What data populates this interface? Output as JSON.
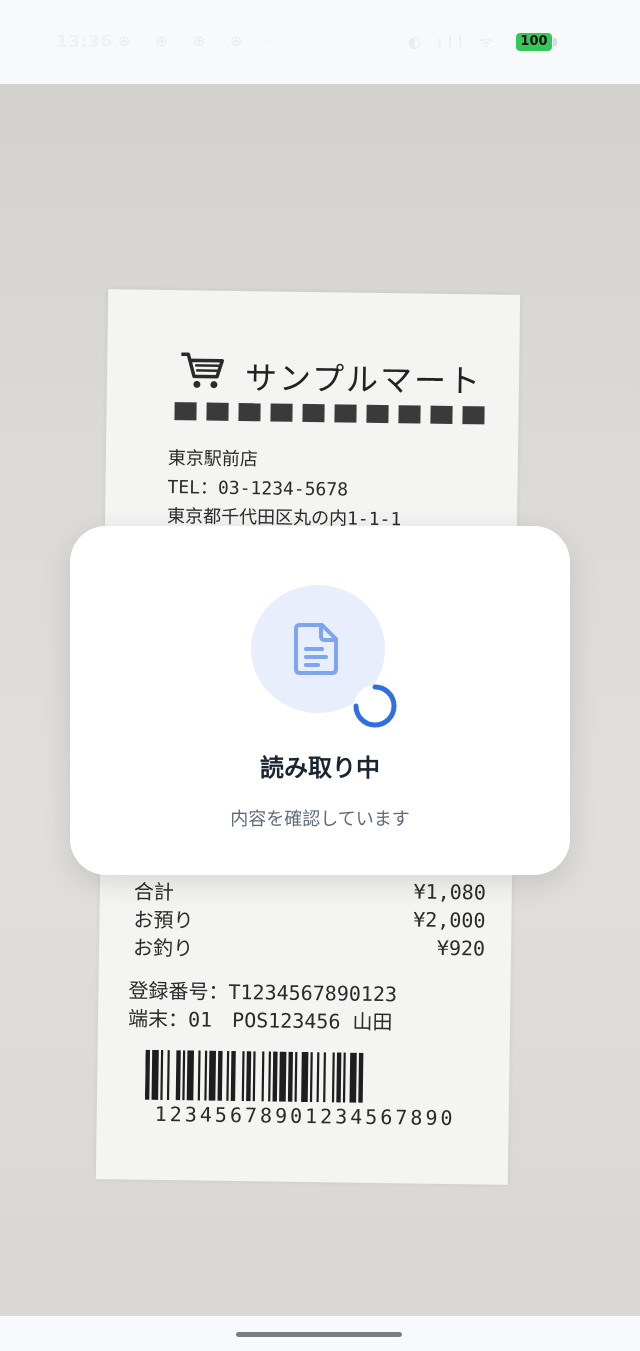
{
  "status_bar": {
    "time": "13:36",
    "left_icons": "⊕ ⊕ ⊕ ⊕ ·",
    "right_icons": "◐ ıll ᯤ",
    "battery": "100"
  },
  "receipt": {
    "store_name": "サンプルマート",
    "branch": "東京駅前店",
    "tel": "TEL：03-1234-5678",
    "address": "東京都千代田区丸の内1-1-1",
    "total_label": "合計",
    "total_value": "¥1,080",
    "paid_label": "お預り",
    "paid_value": "¥2,000",
    "change_label": "お釣り",
    "change_value": "¥920",
    "registration": "登録番号：T1234567890123",
    "terminal": "端末：01　POS123456 山田",
    "barcode_number": "12345678901234567890"
  },
  "loading_dialog": {
    "title": "読み取り中",
    "subtitle": "内容を確認しています"
  },
  "icons": {
    "document": "document-icon",
    "spinner": "loading-spinner-icon",
    "cart": "shopping-cart-icon"
  },
  "colors": {
    "accent": "#2f6fe0",
    "doc_circle": "#e8eefc",
    "battery": "#34c759"
  }
}
